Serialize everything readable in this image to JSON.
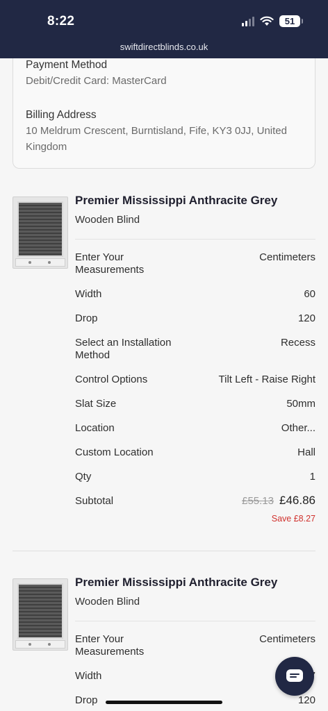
{
  "status_bar": {
    "time": "8:22",
    "battery": "51"
  },
  "browser": {
    "url": "swiftdirectblinds.co.uk"
  },
  "summary": {
    "payment_label": "Payment Method",
    "payment_value": "Debit/Credit Card: MasterCard",
    "billing_label": "Billing Address",
    "billing_value": "10 Meldrum Crescent, Burntisland, Fife, KY3 0JJ, United Kingdom"
  },
  "items": [
    {
      "title": "Premier Mississippi Anthracite Grey",
      "subtitle": "Wooden Blind",
      "rows": [
        {
          "label": "Enter Your Measurements",
          "value": "Centimeters"
        },
        {
          "label": "Width",
          "value": "60"
        },
        {
          "label": "Drop",
          "value": "120"
        },
        {
          "label": "Select an Installation Method",
          "value": "Recess"
        },
        {
          "label": "Control Options",
          "value": "Tilt Left - Raise Right"
        },
        {
          "label": "Slat Size",
          "value": "50mm"
        },
        {
          "label": "Location",
          "value": "Other..."
        },
        {
          "label": "Custom Location",
          "value": "Hall"
        },
        {
          "label": "Qty",
          "value": "1"
        }
      ],
      "subtotal_label": "Subtotal",
      "old_price": "£55.13",
      "new_price": "£46.86",
      "save": "Save £8.27"
    },
    {
      "title": "Premier Mississippi Anthracite Grey",
      "subtitle": "Wooden Blind",
      "rows": [
        {
          "label": "Enter Your Measurements",
          "value": "Centimeters"
        },
        {
          "label": "Width",
          "value": "7"
        },
        {
          "label": "Drop",
          "value": "120"
        }
      ]
    }
  ],
  "chat": {
    "icon": "chat-icon"
  }
}
